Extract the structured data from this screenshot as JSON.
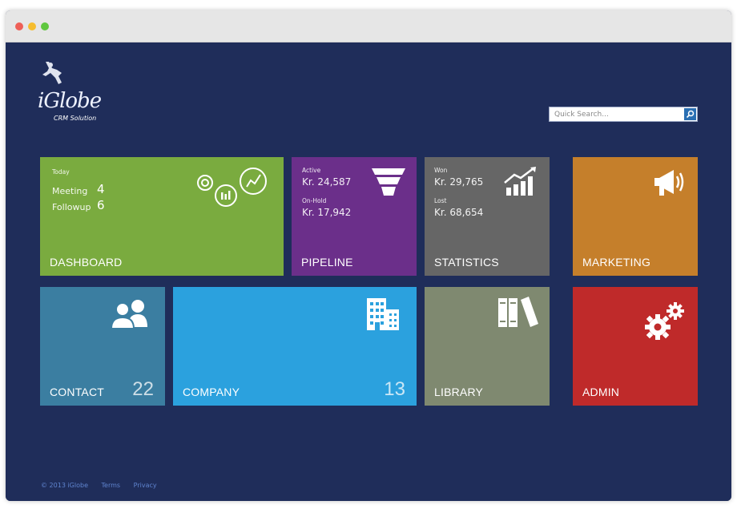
{
  "app": {
    "logo_word": "iGlobe",
    "logo_tagline": "CRM Solution"
  },
  "search": {
    "placeholder": "Quick Search..."
  },
  "tiles": {
    "dashboard": {
      "label": "DASHBOARD",
      "color": "#7aab3f",
      "today_label": "Today",
      "meeting_label": "Meeting",
      "meeting_count": "4",
      "followup_label": "Followup",
      "followup_count": "6"
    },
    "pipeline": {
      "label": "PIPELINE",
      "color": "#6b2f8a",
      "active_label": "Active",
      "active_value": "Kr. 24,587",
      "onhold_label": "On-Hold",
      "onhold_value": "Kr. 17,942"
    },
    "statistics": {
      "label": "STATISTICS",
      "color": "#666666",
      "won_label": "Won",
      "won_value": "Kr. 29,765",
      "lost_label": "Lost",
      "lost_value": "Kr. 68,654"
    },
    "marketing": {
      "label": "MARKETING",
      "color": "#c57f2b"
    },
    "contact": {
      "label": "CONTACT",
      "count": "22",
      "color": "#3b7ea1"
    },
    "company": {
      "label": "COMPANY",
      "count": "13",
      "color": "#2ba1de"
    },
    "library": {
      "label": "LIBRARY",
      "color": "#7f8970"
    },
    "admin": {
      "label": "ADMIN",
      "color": "#bf2a2a"
    }
  },
  "footer": {
    "copyright": "© 2013 iGlobe",
    "terms": "Terms",
    "privacy": "Privacy"
  }
}
